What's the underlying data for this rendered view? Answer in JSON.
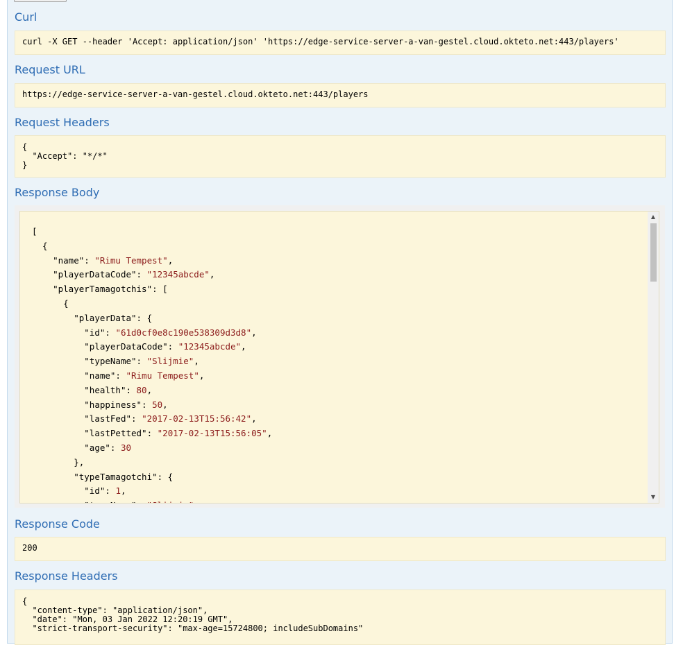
{
  "sections": {
    "curl": {
      "title": "Curl",
      "value": "curl -X GET --header 'Accept: application/json' 'https://edge-service-server-a-van-gestel.cloud.okteto.net:443/players'"
    },
    "request_url": {
      "title": "Request URL",
      "value": "https://edge-service-server-a-van-gestel.cloud.okteto.net:443/players"
    },
    "request_headers": {
      "title": "Request Headers",
      "value": "{\n  \"Accept\": \"*/*\"\n}"
    },
    "response_body": {
      "title": "Response Body",
      "lines": [
        "[",
        "  {",
        "    \"name\": \"Rimu Tempest\",",
        "    \"playerDataCode\": \"12345abcde\",",
        "    \"playerTamagotchis\": [",
        "      {",
        "        \"playerData\": {",
        "          \"id\": \"61d0cf0e8c190e538309d3d8\",",
        "          \"playerDataCode\": \"12345abcde\",",
        "          \"typeName\": \"Slijmie\",",
        "          \"name\": \"Rimu Tempest\",",
        "          \"health\": 80,",
        "          \"happiness\": 50,",
        "          \"lastFed\": \"2017-02-13T15:56:42\",",
        "          \"lastPetted\": \"2017-02-13T15:56:05\",",
        "          \"age\": 30",
        "        },",
        "        \"typeTamagotchi\": {",
        "          \"id\": 1,",
        "          \"typeName\": \"Slijmie\","
      ]
    },
    "response_code": {
      "title": "Response Code",
      "value": "200"
    },
    "response_headers": {
      "title": "Response Headers",
      "value": "{\n  \"content-type\": \"application/json\",\n  \"date\": \"Mon, 03 Jan 2022 12:20:19 GMT\",\n  \"strict-transport-security\": \"max-age=15724800; includeSubDomains\""
    }
  },
  "scrollbar": {
    "up_icon": "▲",
    "down_icon": "▼",
    "position": 0.0
  }
}
